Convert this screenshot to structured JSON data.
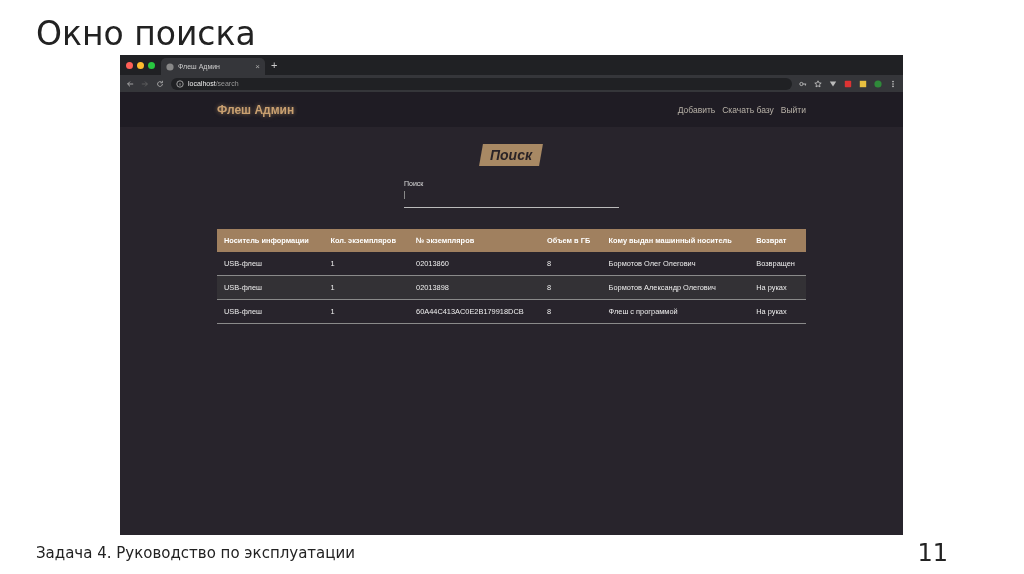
{
  "slide": {
    "title": "Окно поиска",
    "footer": "Задача 4. Руководство по эксплуатации",
    "page_number": "11"
  },
  "browser": {
    "tabs": [
      {
        "title": "Флеш Админ",
        "selected": true,
        "close": "×"
      }
    ],
    "new_tab": "+",
    "address": "**localhost**/search"
  },
  "navbar": {
    "brand": "Флеш Админ",
    "links": [
      "Добавить",
      "Скачать базу",
      "Выйти"
    ]
  },
  "heading": "Поиск",
  "search": {
    "label": "Поиск"
  },
  "table": {
    "columns": [
      "Носитель информации",
      "Кол. экземпляров",
      "№ экземпляров",
      "Объем в ГБ",
      "Кому выдан машинный носитель",
      "Возврат"
    ],
    "rows": [
      [
        "USB-флеш",
        "1",
        "02013860",
        "8",
        "Бормотов Олег Олегович",
        "Возвращен"
      ],
      [
        "USB-флеш",
        "1",
        "02013898",
        "8",
        "Бормотов Александр Олегович",
        "На руках"
      ],
      [
        "USB-флеш",
        "1",
        "60A44C413AC0E2B179918DCB",
        "8",
        "Флеш с программой",
        "На руках"
      ]
    ]
  }
}
